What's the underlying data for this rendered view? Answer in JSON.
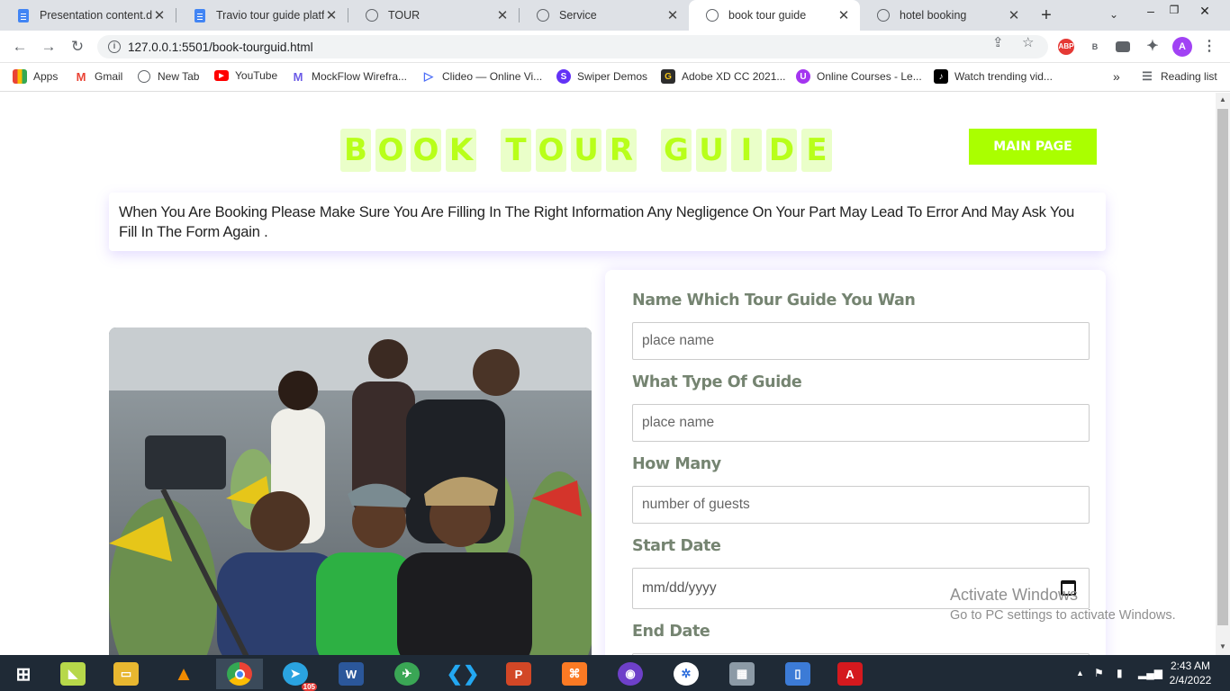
{
  "browser": {
    "tabs": [
      {
        "label": "Presentation content.do",
        "icon": "docs-icon"
      },
      {
        "label": "Travio tour guide platfo",
        "icon": "docs-icon"
      },
      {
        "label": "TOUR",
        "icon": "globe-icon"
      },
      {
        "label": "Service",
        "icon": "globe-icon"
      },
      {
        "label": "book tour guide",
        "icon": "globe-icon",
        "active": true
      },
      {
        "label": "hotel booking",
        "icon": "globe-icon"
      }
    ],
    "url": "127.0.0.1:5501/book-tourguid.html",
    "extensions": {
      "abp": "ABP",
      "b": "B",
      "avatar": "A"
    },
    "bookmarks": [
      {
        "label": "Apps"
      },
      {
        "label": "Gmail"
      },
      {
        "label": "New Tab"
      },
      {
        "label": "YouTube"
      },
      {
        "label": "MockFlow Wirefra..."
      },
      {
        "label": "Clideo — Online Vi..."
      },
      {
        "label": "Swiper Demos"
      },
      {
        "label": "Adobe XD CC 2021..."
      },
      {
        "label": "Online Courses - Le..."
      },
      {
        "label": "Watch trending vid..."
      }
    ],
    "bookmarks_more": "»",
    "reading_list": "Reading list"
  },
  "page": {
    "title_words": [
      "BOOK",
      "TOUR",
      "GUIDE"
    ],
    "main_button": "MAIN PAGE",
    "notice": "When You Are Booking Please Make Sure You Are Filling In The Right Information Any Negligence On Your Part May Lead To Error And May Ask You Fill In The Form Again .",
    "form": {
      "guide_name_label": "Name Which Tour Guide You Wan",
      "guide_name_placeholder": "place name",
      "guide_type_label": "What Type Of Guide",
      "guide_type_placeholder": "place name",
      "how_many_label": "How Many",
      "how_many_placeholder": "number of guests",
      "start_date_label": "Start Date",
      "start_date_placeholder": "mm/dd/yyyy",
      "end_date_label": "End Date"
    }
  },
  "os": {
    "watermark_title": "Activate Windows",
    "watermark_sub": "Go to PC settings to activate Windows.",
    "telegram_badge": "105",
    "time": "2:43 AM",
    "date": "2/4/2022"
  },
  "colors": {
    "accent_green": "#aaff00",
    "title_text": "#b8ff1a",
    "title_bg": "#eaffc9",
    "label_color": "#758471"
  }
}
